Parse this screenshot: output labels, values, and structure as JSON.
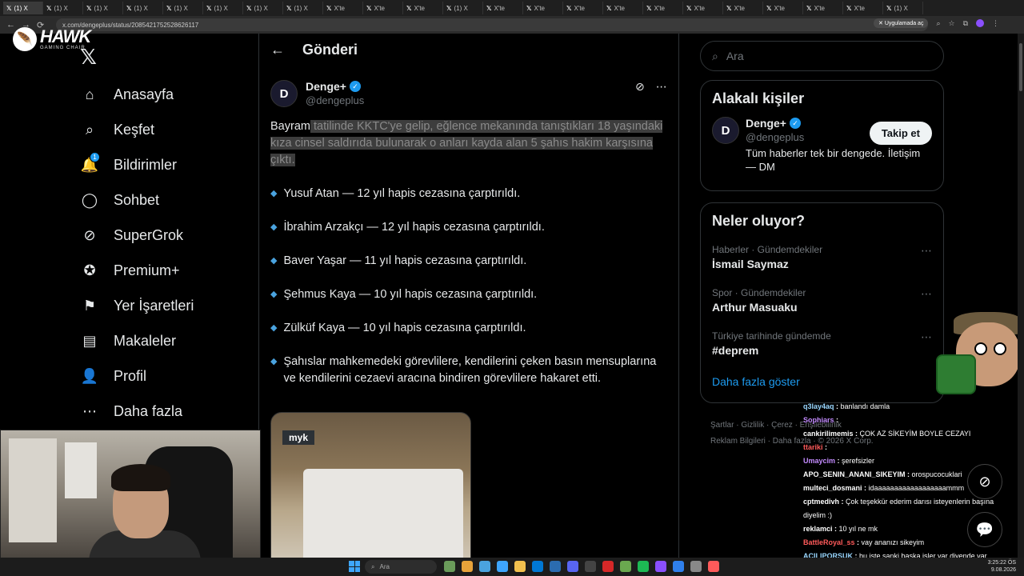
{
  "browser": {
    "tab_labels": [
      "(1) X",
      "(1) X",
      "(1) X",
      "(1) X",
      "(1) X",
      "(1) X",
      "(1) X",
      "(1) X",
      "X'te",
      "X'te",
      "X'te",
      "(1) X",
      "X'te",
      "X'te",
      "X'te",
      "X'te",
      "X'te",
      "X'te",
      "X'te",
      "X'te",
      "X'te",
      "X'te",
      "(1) X"
    ],
    "url": "x.com/dengeplus/status/2085421752528626117",
    "open_app_label": "Uygulamada aç"
  },
  "overlay": {
    "brand": "HAWK",
    "brand_sub": "GAMING CHAIR"
  },
  "sidebar": {
    "items": [
      {
        "label": "Anasayfa",
        "icon": "home-icon"
      },
      {
        "label": "Keşfet",
        "icon": "search-icon"
      },
      {
        "label": "Bildirimler",
        "icon": "bell-icon",
        "badge": "1"
      },
      {
        "label": "Sohbet",
        "icon": "chat-icon"
      },
      {
        "label": "SuperGrok",
        "icon": "grok-icon"
      },
      {
        "label": "Premium+",
        "icon": "verified-icon"
      },
      {
        "label": "Yer İşaretleri",
        "icon": "bookmark-icon"
      },
      {
        "label": "Makaleler",
        "icon": "article-icon"
      },
      {
        "label": "Profil",
        "icon": "profile-icon"
      },
      {
        "label": "Daha fazla",
        "icon": "more-icon"
      }
    ]
  },
  "post": {
    "header_title": "Gönderi",
    "author_name": "Denge+",
    "author_handle": "@dengeplus",
    "intro_plain": "Bayram",
    "intro_highlight": " tatilinde KKTC'ye gelip, eğlence mekanında tanıştıkları 18 yaşındaki kıza cinsel saldırıda bulunarak o anları kayda alan 5 şahıs hakim karşısına çıktı.",
    "sentences": [
      "Yusuf Atan — 12 yıl hapis cezasına çarptırıldı.",
      "İbrahim Arzakçı — 12 yıl hapis cezasına çarptırıldı.",
      "Baver Yaşar — 11 yıl hapis cezasına çarptırıldı.",
      "Şehmus Kaya — 10 yıl hapis cezasına çarptırıldı.",
      "Zülküf Kaya — 10 yıl hapis cezasına çarptırıldı.",
      "Şahıslar mahkemedeki görevlilere, kendilerini çeken basın mensuplarına ve kendilerini cezaevi aracına bindiren görevlilere hakaret etti."
    ],
    "media_label": "myk"
  },
  "right": {
    "search_placeholder": "Ara",
    "related_title": "Alakalı kişiler",
    "related": {
      "name": "Denge+",
      "handle": "@dengeplus",
      "bio": "Tüm haberler tek bir dengede. İletişim — DM",
      "follow_label": "Takip et"
    },
    "trending_title": "Neler oluyor?",
    "trends": [
      {
        "category": "Haberler · Gündemdekiler",
        "name": "İsmail Saymaz"
      },
      {
        "category": "Spor · Gündemdekiler",
        "name": "Arthur Masuaku"
      },
      {
        "category": "Türkiye tarihinde gündemde",
        "name": "#deprem"
      }
    ],
    "show_more": "Daha fazla göster",
    "footer_line1": "Şartlar · Gizlilik · Çerez · Erişilebilirlik",
    "footer_line2": "Reklam Bilgileri · Daha fazla · © 2026 X Corp."
  },
  "chat": [
    {
      "user": "q3lay4aq",
      "msg": "banlandı damla",
      "color": "blue"
    },
    {
      "user": "Sophiars",
      "msg": "",
      "color": "purple"
    },
    {
      "user": "cankirilimemis",
      "msg": "ÇOK AZ SİKEYİM BOYLE CEZAYI",
      "color": "white"
    },
    {
      "user": "ttariki",
      "msg": "",
      "color": "red"
    },
    {
      "user": "Umaycim",
      "msg": "şerefsizler",
      "color": "purple"
    },
    {
      "user": "APO_SENIN_ANANI_SIKEYIM",
      "msg": "orospucocuklari",
      "color": "white"
    },
    {
      "user": "multeci_dosmani",
      "msg": "idaaaaaaaaaaaaaaaaaammm",
      "color": "white"
    },
    {
      "user": "cptmedivh",
      "msg": "Çok teşekkür ederim darısı isteyenlerin başına",
      "color": "white"
    },
    {
      "user": "",
      "msg": "diyelim :)",
      "color": "white"
    },
    {
      "user": "reklamci",
      "msg": "10 yıl ne mk",
      "color": "white"
    },
    {
      "user": "BattleRoyal_ss",
      "msg": "vay ananızı sikeyim",
      "color": "red"
    },
    {
      "user": "ACILIPORSUK",
      "msg": "bu işte sanki başka işler var diyende var",
      "color": "blue"
    }
  ],
  "taskbar": {
    "search_label": "Ara",
    "time": "3:25:22 ÖS",
    "date": "9.08.2026"
  }
}
